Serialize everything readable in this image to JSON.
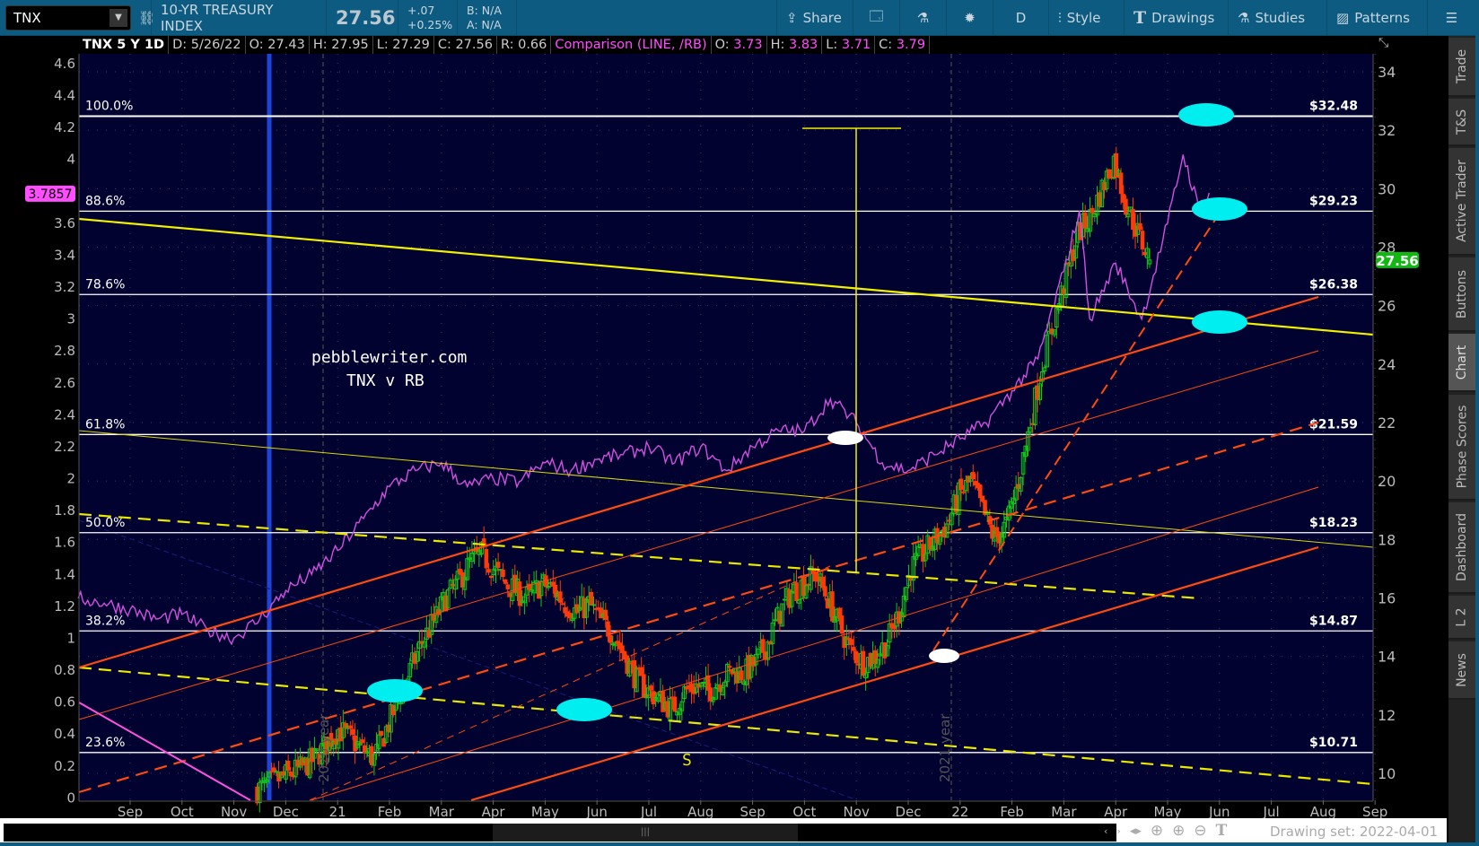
{
  "toolbar": {
    "symbol": "TNX",
    "description": "10-YR TREASURY INDEX",
    "last": "27.56",
    "change": "+.07",
    "change_pct": "+0.25%",
    "bid": "B: N/A",
    "ask": "A: N/A",
    "buttons": {
      "share": "Share",
      "timeframe": "D",
      "style": "Style",
      "drawings": "Drawings",
      "studies": "Studies",
      "patterns": "Patterns"
    }
  },
  "infobar": {
    "title": "TNX 5 Y 1D",
    "date": "D: 5/26/22",
    "open": "O: 27.43",
    "high": "H: 27.95",
    "low": "L: 27.29",
    "close": "C: 27.56",
    "range": "R: 0.66",
    "comparison": "Comparison (LINE, /RB)",
    "c_open_label": "O:",
    "c_open": "3.73",
    "c_high_label": "H:",
    "c_high": "3.83",
    "c_low_label": "L:",
    "c_low": "3.71",
    "c_close_label": "C:",
    "c_close": "3.79"
  },
  "side_tabs": [
    "Trade",
    "T&S",
    "Active Trader",
    "Buttons",
    "Chart",
    "Phase Scores",
    "Dashboard",
    "L 2",
    "News"
  ],
  "active_tab": "Chart",
  "bottom": {
    "drawing_set": "Drawing set: 2022-04-01"
  },
  "chart_data": {
    "type": "candlestick+line",
    "left_axis": {
      "min": 0,
      "max": 4.6,
      "step": 0.2,
      "ticks": [
        "0",
        "0.2",
        "0.4",
        "0.6",
        "0.8",
        "1",
        "1.2",
        "1.4",
        "1.6",
        "1.8",
        "2",
        "2.2",
        "2.4",
        "2.6",
        "2.8",
        "3",
        "3.2",
        "3.4",
        "3.6",
        "3.8",
        "4",
        "4.2",
        "4.4",
        "4.6"
      ],
      "marker": "3.7857"
    },
    "right_axis": {
      "min": 9.3,
      "max": 34.4,
      "ticks": [
        "10",
        "12",
        "14",
        "16",
        "18",
        "20",
        "22",
        "24",
        "26",
        "28",
        "30",
        "32",
        "34"
      ],
      "marker": "27.56"
    },
    "x_ticks": [
      "Sep",
      "Oct",
      "Nov",
      "Dec",
      "21",
      "Feb",
      "Mar",
      "Apr",
      "May",
      "Jun",
      "Jul",
      "Aug",
      "Sep",
      "Oct",
      "Nov",
      "Dec",
      "22",
      "Feb",
      "Mar",
      "Apr",
      "May",
      "Jun",
      "Jul",
      "Aug",
      "Sep"
    ],
    "main_series": {
      "name": "TNX",
      "start_month_index": 2.45,
      "weekly_closes": [
        9.6,
        9.8,
        10.0,
        10.2,
        10.5,
        11.0,
        11.5,
        11.2,
        10.8,
        10.5,
        11.5,
        12.5,
        13.5,
        14.5,
        15.2,
        16.0,
        16.5,
        17.2,
        17.5,
        17.0,
        16.5,
        16.2,
        16.0,
        16.5,
        16.3,
        15.8,
        15.5,
        15.8,
        15.2,
        14.8,
        14.0,
        13.2,
        12.8,
        12.5,
        12.2,
        12.8,
        13.0,
        12.8,
        13.2,
        13.5,
        13.4,
        13.8,
        14.5,
        15.5,
        16.2,
        16.5,
        16.8,
        16.0,
        15.0,
        14.2,
        13.8,
        14.0,
        14.5,
        15.5,
        17.0,
        17.5,
        18.0,
        18.5,
        19.5,
        20.0,
        19.0,
        18.0,
        18.5,
        20.0,
        22.0,
        24.0,
        25.5,
        27.0,
        28.5,
        29.0,
        30.0,
        31.0,
        29.5,
        28.5,
        27.56
      ],
      "last_bar": {
        "open": 27.43,
        "high": 27.95,
        "low": 27.29,
        "close": 27.56
      }
    },
    "comparison_series": {
      "name": "/RB",
      "points": [
        [
          -1,
          1.25
        ],
        [
          -0.5,
          1.22
        ],
        [
          0,
          1.18
        ],
        [
          0.5,
          1.12
        ],
        [
          1,
          1.15
        ],
        [
          1.5,
          1.05
        ],
        [
          2,
          1.0
        ],
        [
          2.5,
          1.12
        ],
        [
          3,
          1.3
        ],
        [
          3.5,
          1.4
        ],
        [
          4,
          1.55
        ],
        [
          4.5,
          1.75
        ],
        [
          5,
          1.95
        ],
        [
          5.5,
          2.05
        ],
        [
          6,
          2.1
        ],
        [
          6.5,
          1.95
        ],
        [
          7,
          2.0
        ],
        [
          7.5,
          1.98
        ],
        [
          8,
          2.1
        ],
        [
          8.5,
          2.05
        ],
        [
          9,
          2.12
        ],
        [
          9.5,
          2.15
        ],
        [
          10,
          2.2
        ],
        [
          10.5,
          2.1
        ],
        [
          11,
          2.2
        ],
        [
          11.5,
          2.05
        ],
        [
          12,
          2.2
        ],
        [
          12.5,
          2.3
        ],
        [
          13,
          2.3
        ],
        [
          13.5,
          2.5
        ],
        [
          14,
          2.35
        ],
        [
          14.5,
          2.1
        ],
        [
          15,
          2.05
        ],
        [
          15.5,
          2.15
        ],
        [
          16,
          2.25
        ],
        [
          16.5,
          2.35
        ],
        [
          17,
          2.55
        ],
        [
          17.5,
          2.75
        ],
        [
          18,
          3.3
        ],
        [
          18.3,
          3.68
        ],
        [
          18.5,
          3.0
        ],
        [
          19,
          3.35
        ],
        [
          19.5,
          3.0
        ],
        [
          20,
          3.6
        ],
        [
          20.3,
          4.03
        ],
        [
          20.6,
          3.7
        ],
        [
          20.8,
          3.79
        ]
      ]
    },
    "fib_levels": [
      {
        "pct": "100.0%",
        "price": "$32.48",
        "value": 32.48
      },
      {
        "pct": "88.6%",
        "price": "$29.23",
        "value": 29.23
      },
      {
        "pct": "78.6%",
        "price": "$26.38",
        "value": 26.38
      },
      {
        "pct": "61.8%",
        "price": "$21.59",
        "value": 21.59
      },
      {
        "pct": "50.0%",
        "price": "$18.23",
        "value": 18.23
      },
      {
        "pct": "38.2%",
        "price": "$14.87",
        "value": 14.87
      },
      {
        "pct": "23.6%",
        "price": "$10.71",
        "value": 10.71
      }
    ],
    "annotations": {
      "site": "pebblewriter.com",
      "subtitle": "TNX v RB",
      "marker": "S",
      "year_2020": "2020 year",
      "year_2021": "2021 year"
    }
  }
}
